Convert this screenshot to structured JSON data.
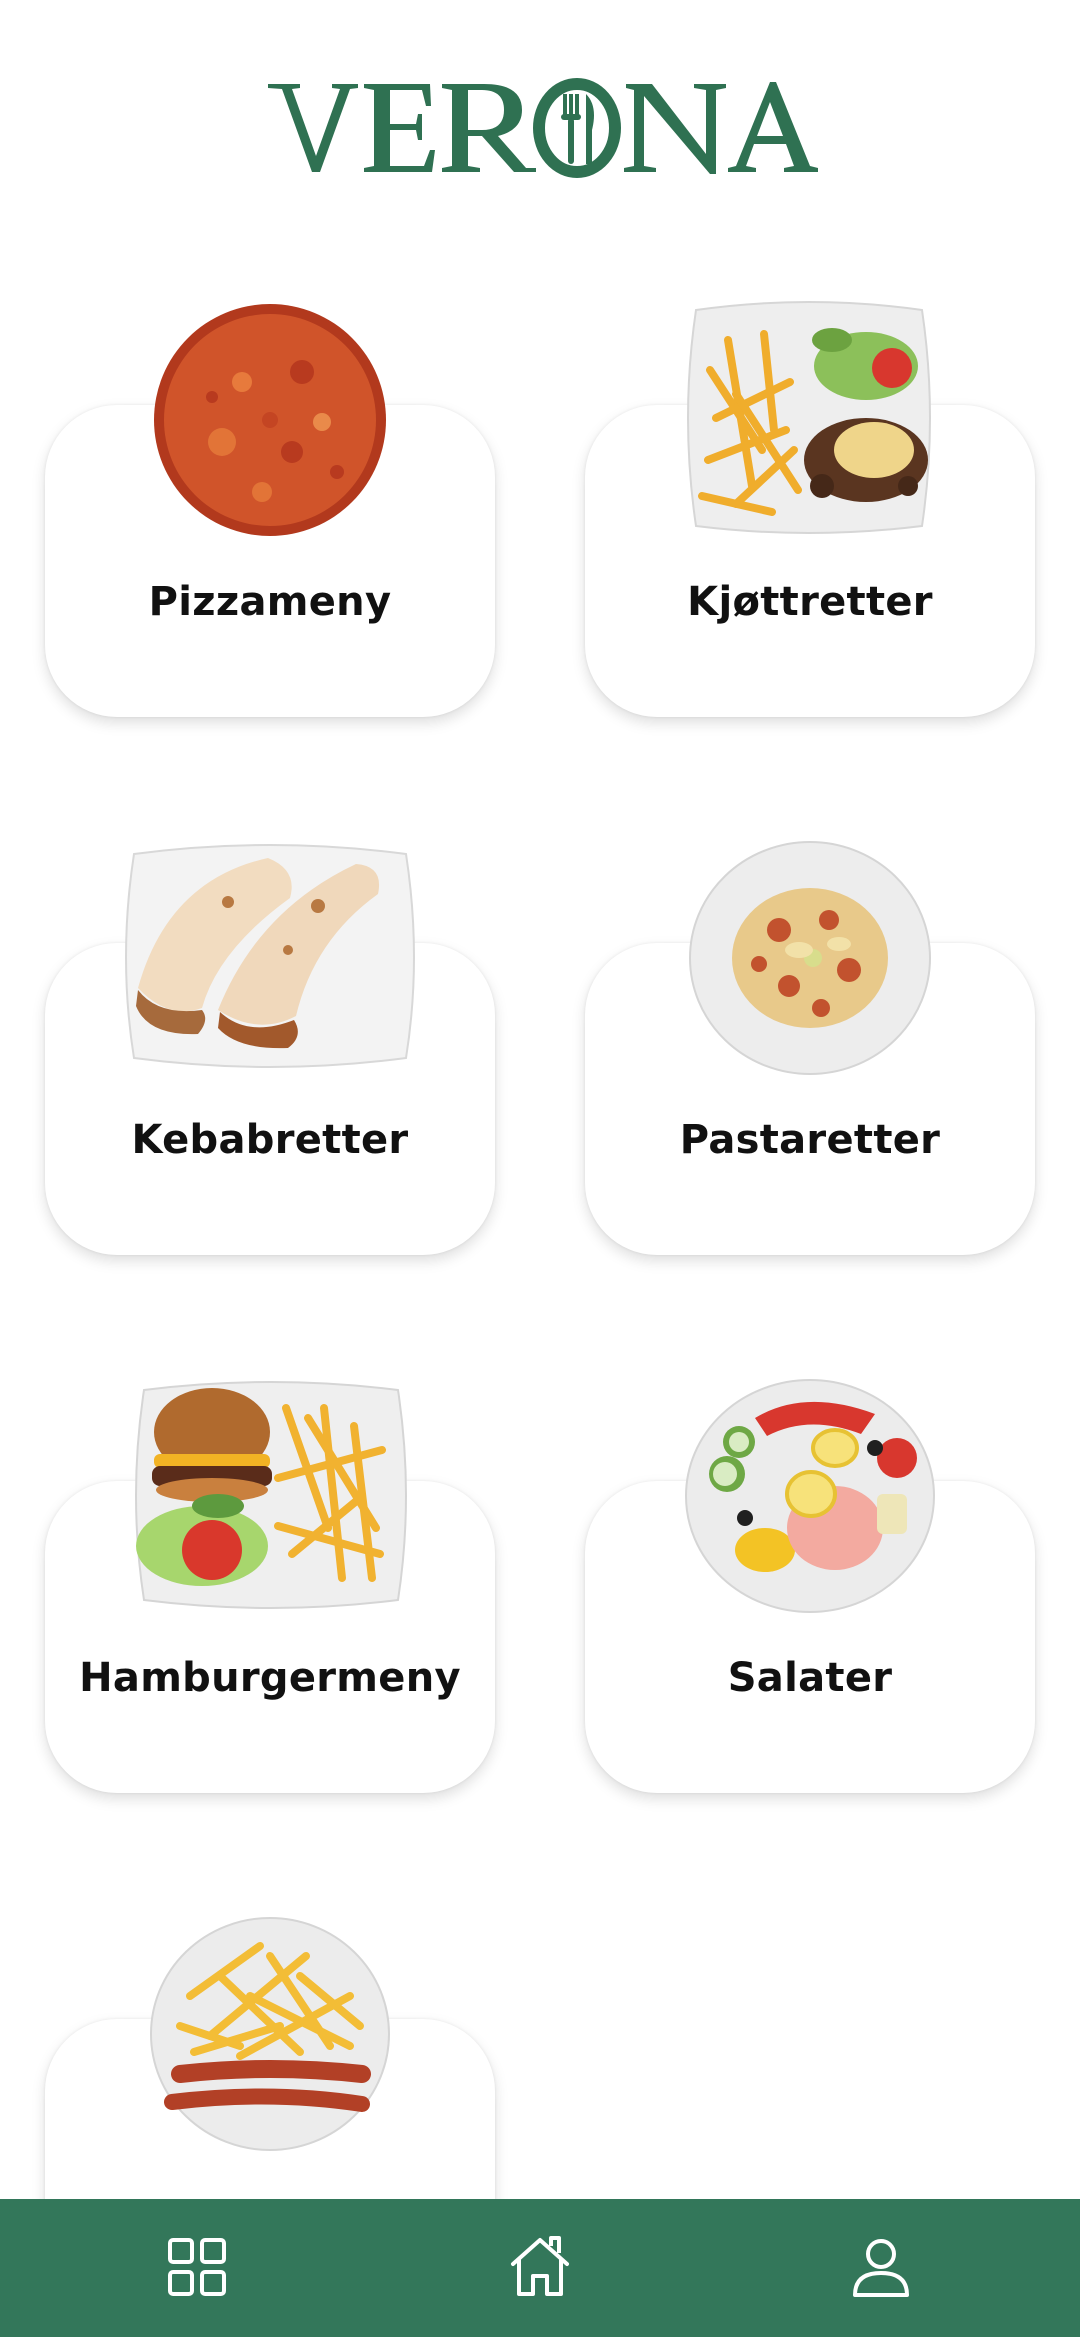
{
  "app": {
    "brand_name": "VERONA",
    "brand_color": "#2f7152"
  },
  "categories": [
    {
      "label": "Pizzameny",
      "image": "pizza"
    },
    {
      "label": "Kjøttretter",
      "image": "meat-with-fries"
    },
    {
      "label": "Kebabretter",
      "image": "kebab-wraps"
    },
    {
      "label": "Pastaretter",
      "image": "pasta-plate"
    },
    {
      "label": "Hamburgermeny",
      "image": "burger-with-fries"
    },
    {
      "label": "Salater",
      "image": "shrimp-salad"
    },
    {
      "label": "",
      "image": "fries-with-sausage"
    }
  ],
  "bottom_nav": {
    "background": "#33775a",
    "items": [
      {
        "icon": "grid-icon"
      },
      {
        "icon": "home-icon"
      },
      {
        "icon": "user-icon"
      }
    ]
  }
}
